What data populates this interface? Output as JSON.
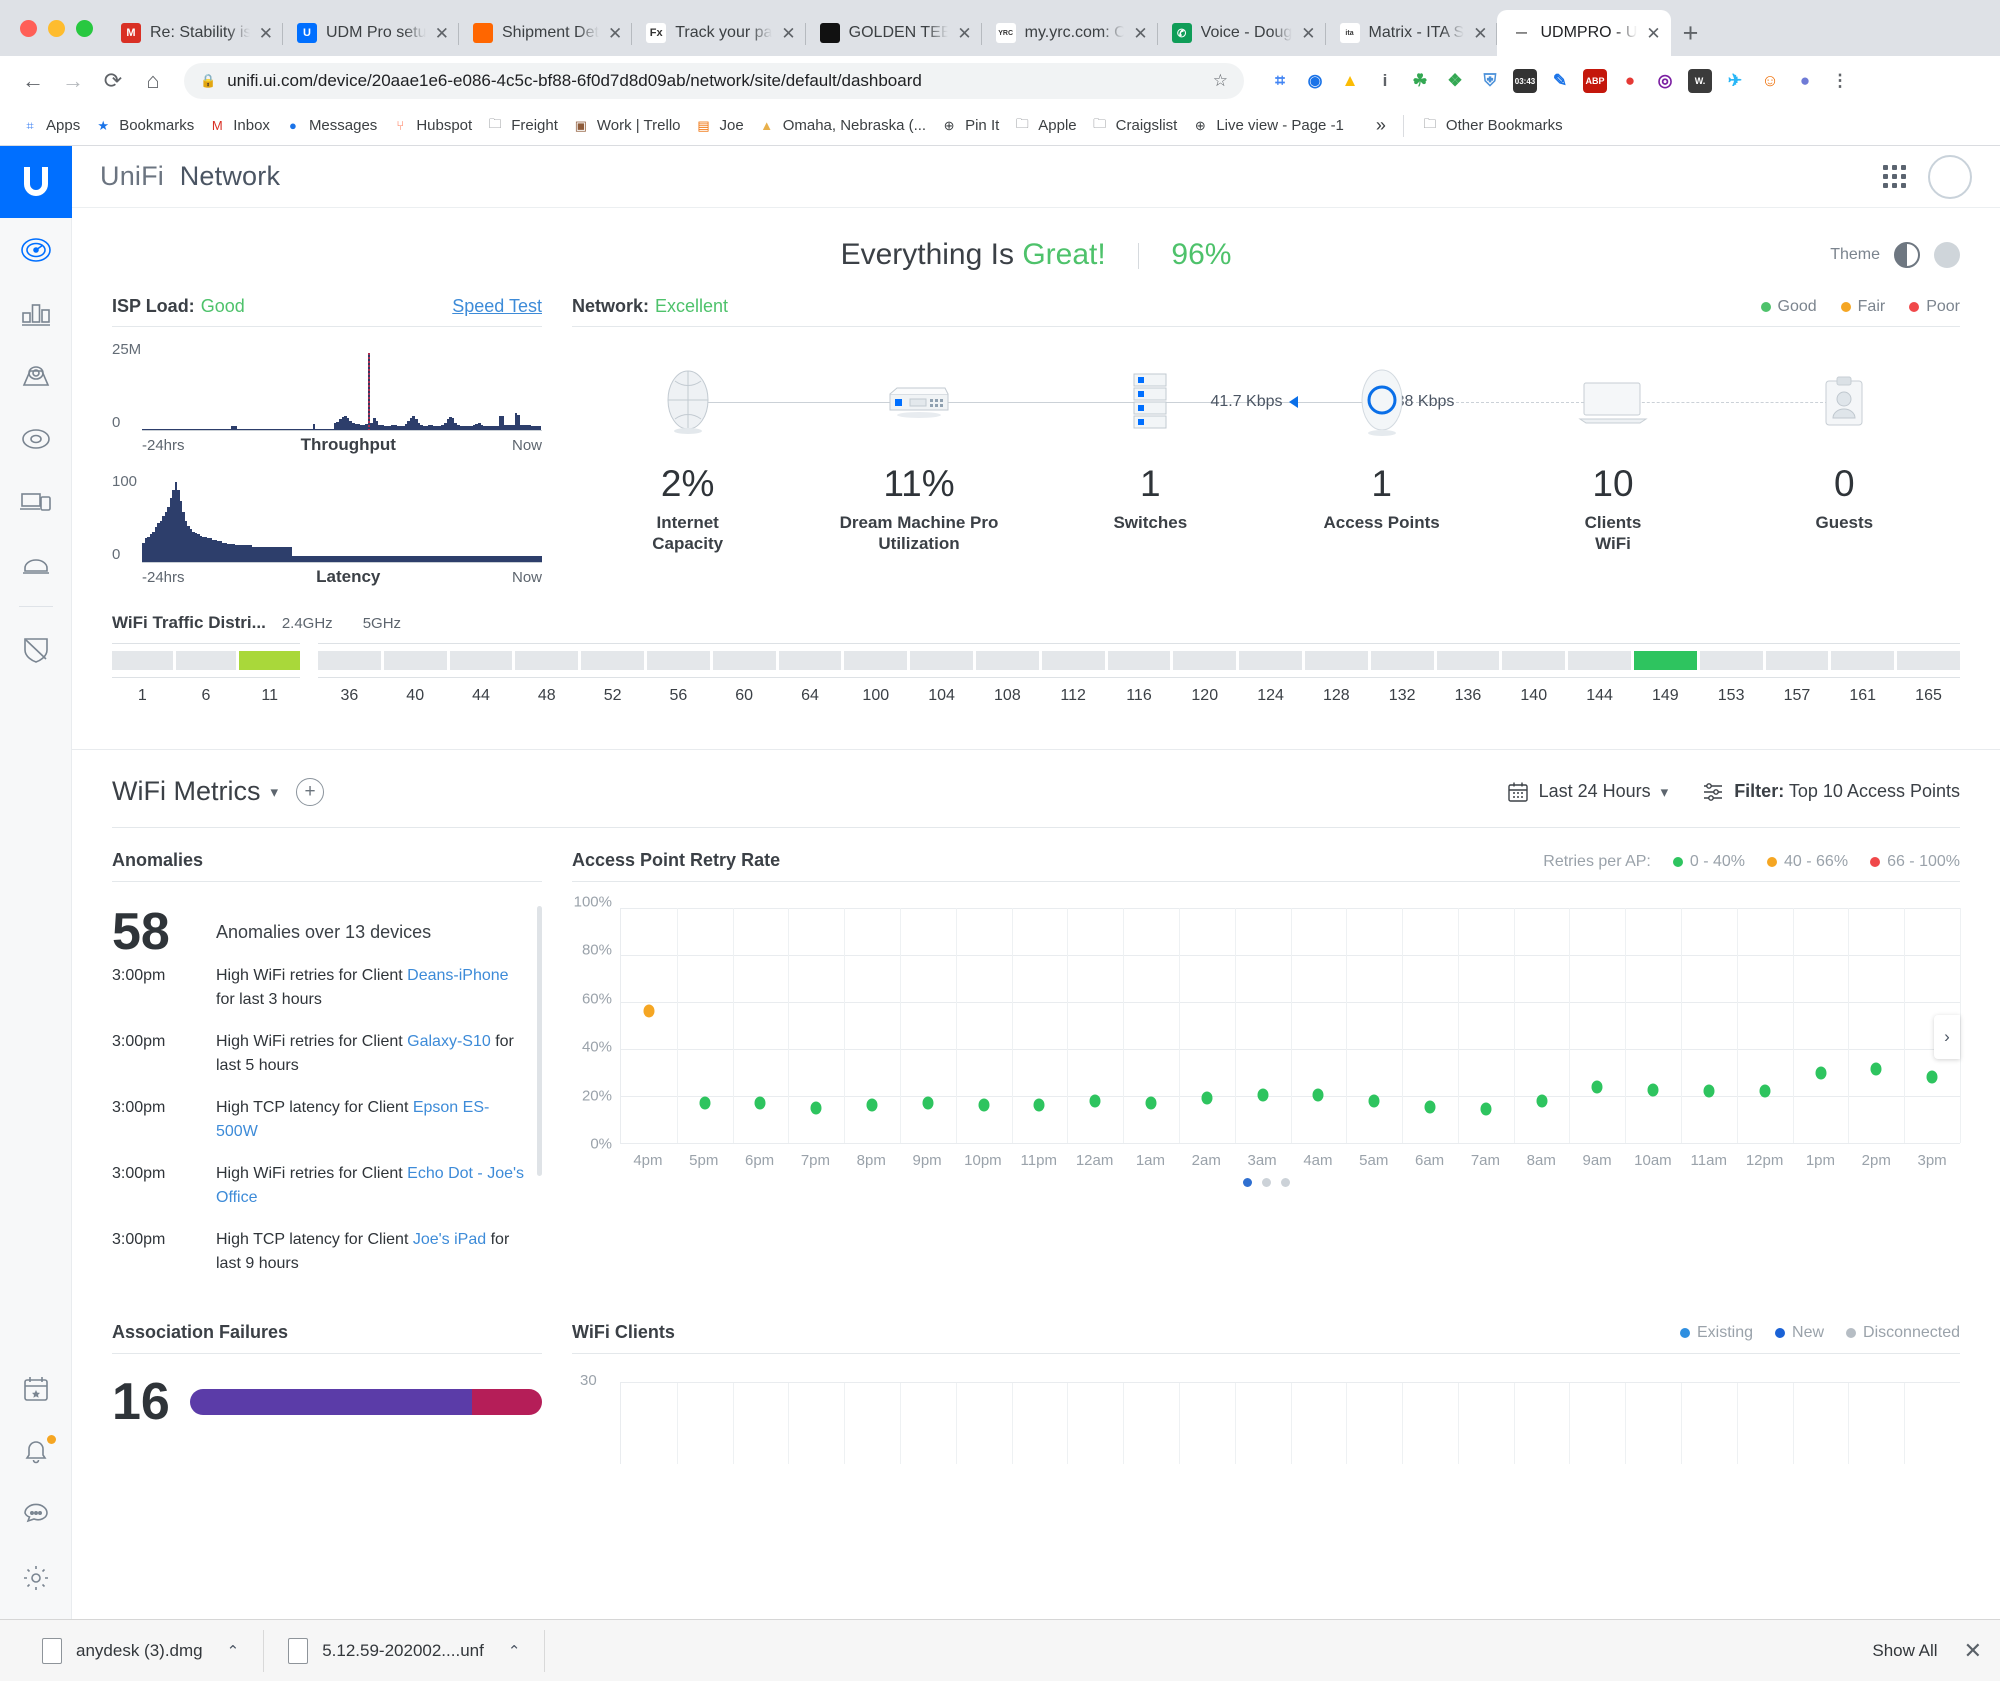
{
  "browser": {
    "tabs": [
      {
        "title": "Re: Stability is",
        "favicon": "gmail-icon",
        "color": "#d93025",
        "glyph": "M"
      },
      {
        "title": "UDM Pro setu",
        "favicon": "ubiquiti-icon",
        "color": "#006fff",
        "glyph": "U"
      },
      {
        "title": "Shipment Det",
        "favicon": "shipment-icon",
        "color": "#ff6600",
        "glyph": ""
      },
      {
        "title": "Track your pa",
        "favicon": "fedex-icon",
        "color": "#ffffff",
        "glyph": "Fx"
      },
      {
        "title": "GOLDEN TEE",
        "favicon": "golden-tee-icon",
        "color": "#111111",
        "glyph": ""
      },
      {
        "title": "my.yrc.com: C",
        "favicon": "yrc-icon",
        "color": "#ffffff",
        "glyph": "YRC"
      },
      {
        "title": "Voice - Doug",
        "favicon": "google-voice-icon",
        "color": "#0f9d58",
        "glyph": "✆"
      },
      {
        "title": "Matrix - ITA S",
        "favicon": "ita-matrix-icon",
        "color": "#ffffff",
        "glyph": "ita"
      },
      {
        "title": "UDMPRO - U",
        "favicon": "unifi-icon",
        "color": "#ffffff",
        "glyph": "—",
        "active": true
      }
    ],
    "close_glyph": "✕",
    "new_tab_glyph": "+",
    "nav": {
      "back": "←",
      "forward": "→",
      "reload": "⟳",
      "home": "⌂",
      "lock": "🔒",
      "url": "unifi.ui.com/device/20aae1e6-e086-4c5c-bf88-6f0d7d8d09ab/network/site/default/dashboard",
      "star": "☆",
      "menu": "⋮"
    },
    "extensions": [
      {
        "name": "apps-grid-icon",
        "glyph": "⌗",
        "color": "#4285f4"
      },
      {
        "name": "blue-circle-icon",
        "glyph": "◉",
        "color": "#1a73e8"
      },
      {
        "name": "drive-icon",
        "glyph": "▲",
        "color": "#fbbc04"
      },
      {
        "name": "info-icon",
        "glyph": "i",
        "color": "#5f6368"
      },
      {
        "name": "green-leaf-icon",
        "glyph": "☘",
        "color": "#34a853"
      },
      {
        "name": "puzzle-icon",
        "glyph": "❖",
        "color": "#34a853"
      },
      {
        "name": "shield-icon",
        "glyph": "⛨",
        "color": "#4a90d9"
      },
      {
        "name": "clock-badge-icon",
        "glyph": "03:43",
        "color": "#333333"
      },
      {
        "name": "pencil-icon",
        "glyph": "✎",
        "color": "#1a73e8"
      },
      {
        "name": "abp-icon",
        "glyph": "ABP",
        "color": "#c4170c"
      },
      {
        "name": "red-dot-icon",
        "glyph": "●",
        "color": "#e53935"
      },
      {
        "name": "ring-icon",
        "glyph": "◎",
        "color": "#7b1fa2"
      },
      {
        "name": "w-icon",
        "glyph": "W.",
        "color": "#3b3b3b"
      },
      {
        "name": "telegram-icon",
        "glyph": "✈",
        "color": "#29b6f6"
      },
      {
        "name": "orange-icon",
        "glyph": "☺",
        "color": "#ef6c00"
      },
      {
        "name": "profile-icon",
        "glyph": "●",
        "color": "#6f7bd6"
      },
      {
        "name": "menu-icon",
        "glyph": "⋮",
        "color": "#5f6368"
      }
    ],
    "bookmarks": [
      {
        "label": "Apps",
        "icon": "apps-grid-icon",
        "glyph": "⌗",
        "color": "#4285f4"
      },
      {
        "label": "Bookmarks",
        "icon": "star-icon",
        "glyph": "★",
        "color": "#1a73e8"
      },
      {
        "label": "Inbox",
        "icon": "gmail-icon",
        "glyph": "M",
        "color": "#d93025"
      },
      {
        "label": "Messages",
        "icon": "messages-icon",
        "glyph": "●",
        "color": "#1a73e8"
      },
      {
        "label": "Hubspot",
        "icon": "hubspot-icon",
        "glyph": "⑂",
        "color": "#ff7a59"
      },
      {
        "label": "Freight",
        "icon": "folder-icon",
        "glyph": "🗀",
        "color": "#5f6368"
      },
      {
        "label": "Work | Trello",
        "icon": "trello-icon",
        "glyph": "▣",
        "color": "#8e5b3a"
      },
      {
        "label": "Joe",
        "icon": "joe-icon",
        "glyph": "▤",
        "color": "#ef6c00"
      },
      {
        "label": "Omaha, Nebraska (...",
        "icon": "weather-icon",
        "glyph": "▲",
        "color": "#e8b04b"
      },
      {
        "label": "Pin It",
        "icon": "globe-icon",
        "glyph": "⊕",
        "color": "#3c4043"
      },
      {
        "label": "Apple",
        "icon": "folder-icon",
        "glyph": "🗀",
        "color": "#5f6368"
      },
      {
        "label": "Craigslist",
        "icon": "folder-icon",
        "glyph": "🗀",
        "color": "#5f6368"
      },
      {
        "label": "Live view - Page -1",
        "icon": "globe-icon",
        "glyph": "⊕",
        "color": "#3c4043"
      }
    ],
    "overflow_glyph": "»",
    "other_bookmarks": {
      "label": "Other Bookmarks",
      "icon": "folder-icon",
      "glyph": "🗀"
    }
  },
  "downloads": {
    "items": [
      {
        "name": "anydesk (3).dmg",
        "caret": "⌃"
      },
      {
        "name": "5.12.59-202002....unf",
        "caret": "⌃"
      }
    ],
    "show_all": "Show All",
    "close": "✕"
  },
  "app": {
    "brand_thin": "UniFi",
    "brand_bold": "Network",
    "sidebar": [
      {
        "name": "ubiquiti-logo",
        "label": "UniFi"
      },
      {
        "name": "sidebar-item-dashboard",
        "label": "Dashboard",
        "selected": true
      },
      {
        "name": "sidebar-item-statistics",
        "label": "Statistics"
      },
      {
        "name": "sidebar-item-topology",
        "label": "Topology"
      },
      {
        "name": "sidebar-item-devices",
        "label": "Devices"
      },
      {
        "name": "sidebar-item-clients",
        "label": "Clients"
      },
      {
        "name": "sidebar-item-insights",
        "label": "Insights"
      },
      {
        "name": "sidebar-item-security",
        "label": "Security"
      }
    ],
    "sidebar_bottom": [
      {
        "name": "sidebar-item-events",
        "label": "Events"
      },
      {
        "name": "sidebar-item-alerts",
        "label": "Alerts",
        "badge": true
      },
      {
        "name": "sidebar-item-chat",
        "label": "Chat"
      },
      {
        "name": "sidebar-item-settings",
        "label": "Settings"
      }
    ],
    "header": {
      "title_prefix": "Everything Is",
      "title_status": "Great!",
      "score": "96%",
      "theme_label": "Theme"
    },
    "isp": {
      "label": "ISP Load:",
      "status": "Good",
      "speed_test": "Speed Test",
      "throughput": {
        "ymax": "25M",
        "ymin": "0",
        "left": "-24hrs",
        "title": "Throughput",
        "right": "Now"
      },
      "latency": {
        "ymax": "100",
        "ymin": "0",
        "left": "-24hrs",
        "title": "Latency",
        "right": "Now"
      }
    },
    "network": {
      "label": "Network:",
      "status": "Excellent",
      "legend": [
        {
          "label": "Good",
          "color": "#4ec26b"
        },
        {
          "label": "Fair",
          "color": "#f5a623"
        },
        {
          "label": "Poor",
          "color": "#f0484a"
        }
      ],
      "down_speed": "41.7 Kbps",
      "up_speed": "3.38 Kbps",
      "nodes": [
        {
          "name": "internet-node",
          "value": "2%",
          "caption": "Internet",
          "caption2": "Capacity",
          "icon": "globe-icon"
        },
        {
          "name": "gateway-node",
          "value": "11%",
          "caption": "Dream Machine Pro",
          "caption2": "Utilization",
          "icon": "gateway-icon"
        },
        {
          "name": "switches-node",
          "value": "1",
          "caption": "Switches",
          "caption2": "",
          "icon": "switch-stack-icon"
        },
        {
          "name": "access-points-node",
          "value": "1",
          "caption": "Access Points",
          "caption2": "",
          "icon": "access-point-icon"
        },
        {
          "name": "clients-node",
          "value": "10",
          "caption": "Clients",
          "caption2": "WiFi",
          "icon": "monitor-icon"
        },
        {
          "name": "guests-node",
          "value": "0",
          "caption": "Guests",
          "caption2": "",
          "icon": "guest-badge-icon"
        }
      ]
    },
    "wifi_distribution": {
      "title": "WiFi Traffic Distri...",
      "band_24": "2.4GHz",
      "band_5": "5GHz",
      "channels_24": [
        "1",
        "6",
        "11"
      ],
      "active_24": "11",
      "active_24_color": "#a9d83a",
      "channels_5": [
        "36",
        "40",
        "44",
        "48",
        "52",
        "56",
        "60",
        "64",
        "100",
        "104",
        "108",
        "112",
        "116",
        "120",
        "124",
        "128",
        "132",
        "136",
        "140",
        "144",
        "149",
        "153",
        "157",
        "161",
        "165"
      ],
      "active_5": "149",
      "active_5_color": "#2ec45f"
    },
    "metrics_bar": {
      "title": "WiFi Metrics",
      "caret": "▾",
      "add": "+",
      "time_range": "Last 24 Hours",
      "time_caret": "▾",
      "filter_label": "Filter:",
      "filter_value": "Top 10 Access Points",
      "calendar_icon": "calendar-icon",
      "filter_icon": "filter-icon"
    },
    "anomalies": {
      "title": "Anomalies",
      "count": "58",
      "subtitle": "Anomalies over 13 devices",
      "rows": [
        {
          "time": "3:00pm",
          "pre": "High WiFi retries for Client ",
          "link": "Deans-iPhone",
          "post": " for last 3 hours"
        },
        {
          "time": "3:00pm",
          "pre": "High WiFi retries for Client ",
          "link": "Galaxy-S10",
          "post": " for last 5 hours"
        },
        {
          "time": "3:00pm",
          "pre": "High TCP latency for Client ",
          "link": "Epson ES-500W",
          "post": ""
        },
        {
          "time": "3:00pm",
          "pre": "High WiFi retries for Client ",
          "link": "Echo Dot - Joe's Office",
          "post": ""
        },
        {
          "time": "3:00pm",
          "pre": "High TCP latency for Client ",
          "link": "Joe's iPad",
          "post": " for last 9 hours"
        }
      ]
    },
    "association_failures": {
      "title": "Association Failures",
      "count": "16",
      "segments": [
        {
          "color": "#5b3ca8",
          "pct": 80
        },
        {
          "color": "#b51e58",
          "pct": 20
        }
      ]
    },
    "wifi_clients": {
      "title": "WiFi Clients",
      "ymax": "30",
      "legend": [
        {
          "label": "Existing",
          "color": "#2f8fe0"
        },
        {
          "label": "New",
          "color": "#1a62d6"
        },
        {
          "label": "Disconnected",
          "color": "#b6bdc4"
        }
      ]
    }
  },
  "chart_data": {
    "type": "scatter",
    "title": "Access Point Retry Rate",
    "legend_label": "Retries per AP:",
    "legend": [
      {
        "label": "0 - 40%",
        "color": "#2ec45f"
      },
      {
        "label": "40 - 66%",
        "color": "#f5a623"
      },
      {
        "label": "66 - 100%",
        "color": "#f0484a"
      }
    ],
    "xlabel": "",
    "ylabel": "",
    "ylim": [
      0,
      100
    ],
    "yticks": [
      "0%",
      "20%",
      "40%",
      "60%",
      "80%",
      "100%"
    ],
    "categories": [
      "4pm",
      "5pm",
      "6pm",
      "7pm",
      "8pm",
      "9pm",
      "10pm",
      "11pm",
      "12am",
      "1am",
      "2am",
      "3am",
      "4am",
      "5am",
      "6am",
      "7am",
      "8am",
      "9am",
      "10am",
      "11am",
      "12pm",
      "1pm",
      "2pm",
      "3pm"
    ],
    "values": [
      56,
      17,
      17,
      15,
      16,
      17,
      16,
      16,
      18,
      17,
      19,
      20.5,
      20.5,
      18,
      15.5,
      14.5,
      18,
      24,
      22.5,
      22,
      22,
      30,
      31.5,
      28
    ],
    "point_colors": [
      "#f5a623",
      "#2ec45f",
      "#2ec45f",
      "#2ec45f",
      "#2ec45f",
      "#2ec45f",
      "#2ec45f",
      "#2ec45f",
      "#2ec45f",
      "#2ec45f",
      "#2ec45f",
      "#2ec45f",
      "#2ec45f",
      "#2ec45f",
      "#2ec45f",
      "#2ec45f",
      "#2ec45f",
      "#2ec45f",
      "#2ec45f",
      "#2ec45f",
      "#2ec45f",
      "#2ec45f",
      "#2ec45f",
      "#2ec45f"
    ],
    "grid": true,
    "legend_position": "top-right",
    "pagination": {
      "pages": 3,
      "active": 0,
      "next_glyph": "›"
    }
  },
  "sparkline_data": {
    "throughput": {
      "type": "bar",
      "ymax_label": "25M",
      "values": [
        0,
        0,
        0,
        0,
        0,
        0,
        0,
        0,
        0,
        0,
        0,
        0,
        0,
        0,
        0,
        0,
        0,
        0,
        0,
        0,
        0,
        0,
        0,
        0,
        0,
        0,
        0,
        0,
        0,
        0,
        0,
        0,
        0,
        0,
        3,
        3,
        0,
        0,
        0,
        0,
        0,
        0,
        0,
        0,
        0,
        0,
        0,
        0,
        0,
        0,
        0,
        0,
        0,
        0,
        0,
        0,
        0,
        0,
        0,
        0,
        0,
        0,
        0,
        0,
        0,
        5,
        0,
        0,
        0,
        0,
        0,
        0,
        0,
        6,
        7,
        9,
        11,
        12,
        10,
        8,
        6,
        5,
        5,
        4,
        4,
        5,
        65,
        6,
        10,
        8,
        4,
        4,
        3,
        3,
        3,
        4,
        4,
        3,
        3,
        3,
        5,
        8,
        10,
        12,
        9,
        6,
        4,
        3,
        3,
        4,
        4,
        3,
        3,
        3,
        4,
        6,
        9,
        11,
        10,
        6,
        4,
        3,
        3,
        3,
        3,
        3,
        4,
        5,
        6,
        4,
        3,
        3,
        3,
        3,
        3,
        3,
        12,
        12,
        4,
        4,
        4,
        4,
        14,
        13,
        4,
        4,
        4,
        4,
        3,
        3,
        3,
        3
      ],
      "spike_index": 86
    },
    "latency": {
      "type": "bar",
      "ymax_label": "100",
      "values": [
        14,
        17,
        18,
        20,
        22,
        25,
        28,
        30,
        33,
        36,
        40,
        46,
        52,
        58,
        52,
        44,
        36,
        30,
        26,
        24,
        22,
        21,
        20,
        19,
        18,
        18,
        17,
        17,
        16,
        16,
        15,
        15,
        14,
        14,
        13,
        13,
        13,
        12,
        12,
        12,
        12,
        12,
        12,
        12,
        11,
        11,
        11,
        11,
        11,
        11,
        11,
        11,
        11,
        11,
        11,
        11,
        11,
        11,
        11,
        11,
        4,
        4,
        4,
        4,
        4,
        4,
        4,
        4,
        4,
        4,
        4,
        4,
        4,
        4,
        4,
        4,
        4,
        4,
        4,
        4,
        4,
        4,
        4,
        4,
        4,
        4,
        4,
        4,
        4,
        4,
        4,
        4,
        4,
        4,
        4,
        4,
        4,
        4,
        4,
        4,
        4,
        4,
        4,
        4,
        4,
        4,
        4,
        4,
        4,
        4,
        4,
        4,
        4,
        4,
        4,
        4,
        4,
        4,
        4,
        4,
        4,
        4,
        4,
        4,
        4,
        4,
        4,
        4,
        4,
        4,
        4,
        4,
        4,
        4,
        4,
        4,
        4,
        4,
        4,
        4,
        4,
        4,
        4,
        4,
        4,
        4,
        4,
        4,
        4,
        4,
        4,
        4,
        4,
        4,
        4,
        4,
        4,
        4,
        4,
        4
      ]
    }
  }
}
